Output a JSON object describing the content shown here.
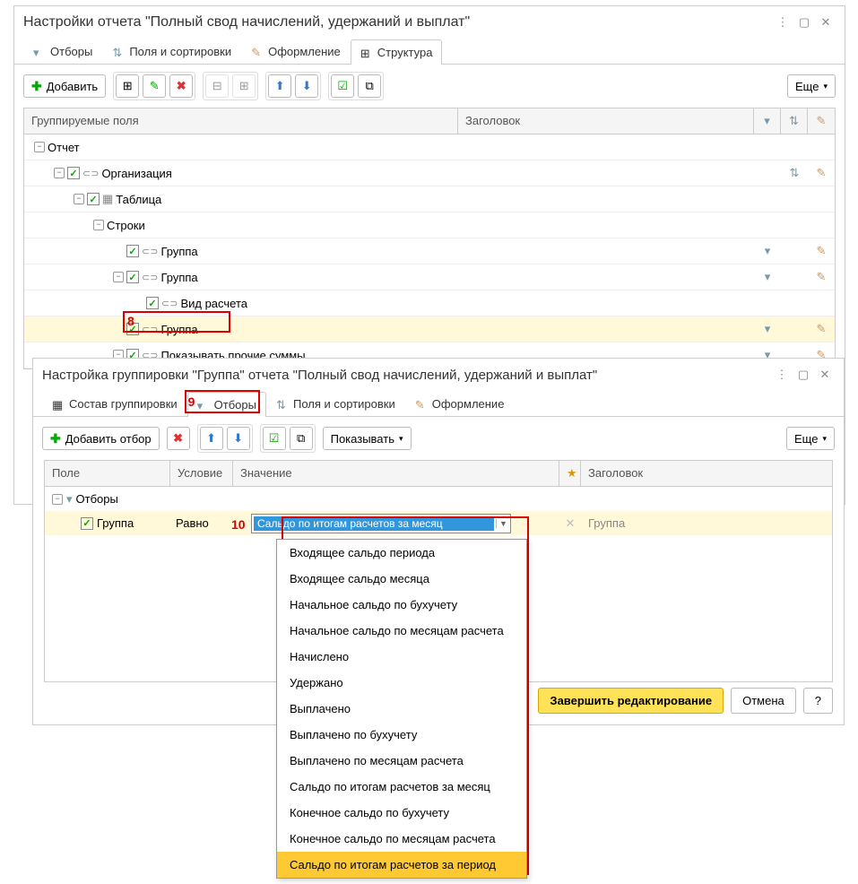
{
  "w1": {
    "title": "Настройки отчета \"Полный свод начислений, удержаний и выплат\"",
    "tabs": [
      "Отборы",
      "Поля и сортировки",
      "Оформление",
      "Структура"
    ],
    "active_tab": 3,
    "add_label": "Добавить",
    "more_label": "Еще",
    "grid_headers": {
      "c1": "Группируемые поля",
      "c2": "Заголовок"
    },
    "rows": [
      {
        "indent": 0,
        "exp": "-",
        "chk": false,
        "icon": "",
        "label": "Отчет"
      },
      {
        "indent": 1,
        "exp": "-",
        "chk": true,
        "icon": "group",
        "label": "Организация",
        "sort": true,
        "brush": true
      },
      {
        "indent": 2,
        "exp": "-",
        "chk": true,
        "icon": "table",
        "label": "Таблица"
      },
      {
        "indent": 3,
        "exp": "-",
        "chk": false,
        "icon": "",
        "label": "Строки"
      },
      {
        "indent": 4,
        "exp": "",
        "chk": true,
        "icon": "group",
        "label": "Группа",
        "funnel": true,
        "brush": true
      },
      {
        "indent": 4,
        "exp": "-",
        "chk": true,
        "icon": "group",
        "label": "Группа",
        "funnel": true,
        "brush": true
      },
      {
        "indent": 5,
        "exp": "",
        "chk": true,
        "icon": "group",
        "label": "Вид расчета"
      },
      {
        "indent": 4,
        "exp": "",
        "chk": true,
        "icon": "group",
        "label": "Группа",
        "selected": true,
        "funnel": true,
        "brush": true,
        "annot": "8"
      },
      {
        "indent": 4,
        "exp": "-",
        "chk": true,
        "icon": "group",
        "label": "Показывать прочие суммы",
        "funnel": true,
        "brush": true
      }
    ]
  },
  "w2": {
    "title": "Настройка группировки \"Группа\" отчета \"Полный свод начислений, удержаний и выплат\"",
    "tabs": [
      "Состав группировки",
      "Отборы",
      "Поля и сортировки",
      "Оформление"
    ],
    "active_tab": 1,
    "annot_tab": "9",
    "add_label": "Добавить отбор",
    "show_label": "Показывать",
    "more_label": "Еще",
    "headers": {
      "c1": "Поле",
      "c2": "Условие",
      "c3": "Значение",
      "c4": "★",
      "c5": "Заголовок"
    },
    "root": "Отборы",
    "row": {
      "field": "Группа",
      "cond": "Равно",
      "val": "Сальдо по итогам расчетов за месяц",
      "title": "Группа",
      "annot": "10"
    },
    "dropdown": [
      "Входящее сальдо периода",
      "Входящее сальдо месяца",
      "Начальное сальдо по бухучету",
      "Начальное сальдо по месяцам расчета",
      "Начислено",
      "Удержано",
      "Выплачено",
      "Выплачено по бухучету",
      "Выплачено по месяцам расчета",
      "Сальдо по итогам расчетов за месяц",
      "Конечное сальдо по бухучету",
      "Конечное сальдо по месяцам расчета",
      "Сальдо по итогам расчетов за период"
    ],
    "dd_highlight": 12,
    "ok_label": "Завершить редактирование",
    "cancel_label": "Отмена",
    "help_label": "?"
  }
}
